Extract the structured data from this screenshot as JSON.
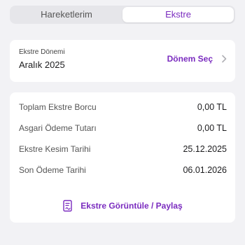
{
  "tabs": {
    "movements_label": "Hareketlerim",
    "statement_label": "Ekstre",
    "active": "statement"
  },
  "period": {
    "label": "Ekstre Dönemi",
    "value": "Aralık 2025",
    "select_label": "Dönem Seç"
  },
  "summary": {
    "rows": [
      {
        "label": "Toplam Ekstre Borcu",
        "value": "0,00 TL"
      },
      {
        "label": "Asgari Ödeme Tutarı",
        "value": "0,00 TL"
      },
      {
        "label": "Ekstre Kesim Tarihi",
        "value": "25.12.2025"
      },
      {
        "label": "Son Ödeme Tarihi",
        "value": "06.01.2026"
      }
    ],
    "action_label": "Ekstre Görüntüle / Paylaş",
    "action_icon": "document-share-icon"
  },
  "colors": {
    "accent": "#7a2bbf",
    "background": "#f2f2f5",
    "card": "#ffffff"
  }
}
